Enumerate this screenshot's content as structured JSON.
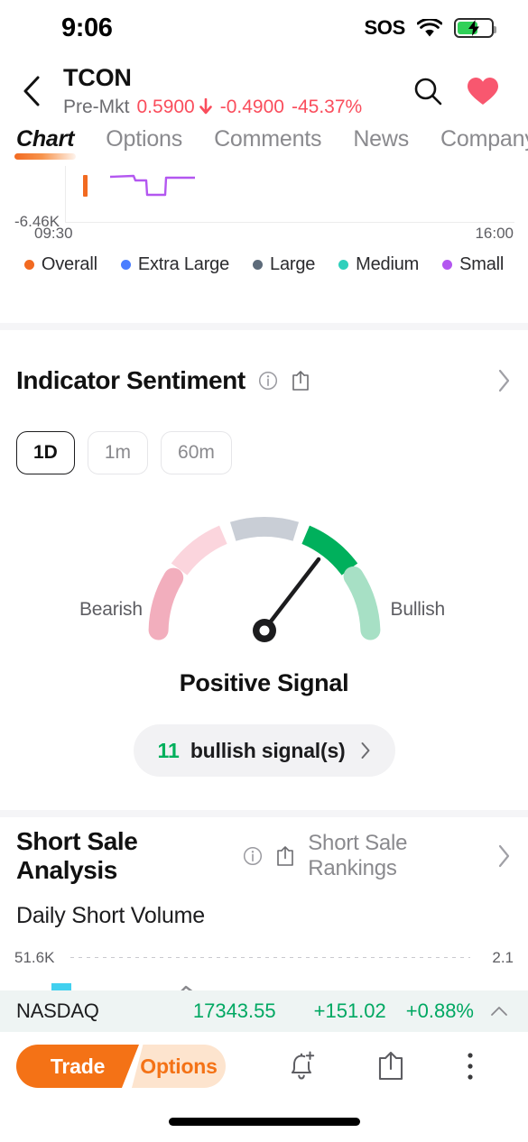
{
  "status_bar": {
    "time": "9:06",
    "sos": "SOS",
    "wifi_icon": "wifi-icon",
    "battery_icon": "battery-charging-icon"
  },
  "header": {
    "back_icon": "chevron-left-icon",
    "ticker": "TCON",
    "session_label": "Pre-Mkt",
    "price": "0.5900",
    "direction_icon": "arrow-down-icon",
    "change": "-0.4900",
    "change_pct": "-45.37%",
    "search_icon": "search-icon",
    "favorite_icon": "heart-icon",
    "negative_color": "#fa4d5c"
  },
  "tabs": [
    {
      "label": "Chart",
      "active": true
    },
    {
      "label": "Options",
      "active": false
    },
    {
      "label": "Comments",
      "active": false
    },
    {
      "label": "News",
      "active": false
    },
    {
      "label": "Company",
      "active": false
    }
  ],
  "top_chart": {
    "y_axis_label": "-6.46K",
    "x_start": "09:30",
    "x_end": "16:00",
    "legend": [
      {
        "label": "Overall",
        "color": "#f26a21"
      },
      {
        "label": "Extra Large",
        "color": "#4a7dff"
      },
      {
        "label": "Large",
        "color": "#5d6b7a"
      },
      {
        "label": "Medium",
        "color": "#2fd0bc"
      },
      {
        "label": "Small",
        "color": "#b357f0"
      }
    ]
  },
  "indicator_sentiment": {
    "title": "Indicator Sentiment",
    "info_icon": "info-icon",
    "share_icon": "share-icon",
    "chevron_icon": "chevron-right-icon",
    "periods": [
      {
        "label": "1D",
        "active": true
      },
      {
        "label": "1m",
        "active": false
      },
      {
        "label": "60m",
        "active": false
      }
    ],
    "gauge": {
      "left_label": "Bearish",
      "right_label": "Bullish",
      "needle_value": 0.72,
      "segments": [
        {
          "name": "strong-bearish",
          "color": "#f2aebd"
        },
        {
          "name": "bearish",
          "color": "#fbd5dd"
        },
        {
          "name": "neutral",
          "color": "#c9ced6"
        },
        {
          "name": "bullish",
          "color": "#00b05c"
        },
        {
          "name": "strong-bullish",
          "color": "#a7e0c5"
        }
      ]
    },
    "signal_text": "Positive Signal",
    "signal_button": {
      "count": "11",
      "label": "bullish signal(s)",
      "chevron_icon": "chevron-right-icon",
      "count_color": "#00b05c"
    }
  },
  "short_sale": {
    "title": "Short Sale Analysis",
    "info_icon": "info-icon",
    "share_icon": "share-icon",
    "rankings_link": "Short Sale Rankings",
    "chevron_icon": "chevron-right-icon",
    "subtitle": "Daily Short Volume",
    "chart": {
      "y_left": "51.6K",
      "y_right": "2.1",
      "bar_color": "#41d0ef",
      "line_color": "#8a8a8e"
    }
  },
  "market_ticker": {
    "name": "NASDAQ",
    "value": "17343.55",
    "change": "+151.02",
    "change_pct": "+0.88%",
    "chevron_icon": "chevron-up-icon",
    "positive_color": "#00a862"
  },
  "toolbar": {
    "trade_label": "Trade",
    "options_label": "Options",
    "alert_icon": "bell-plus-icon",
    "share_icon": "share-icon",
    "more_icon": "more-vertical-icon",
    "accent_color": "#f47216"
  }
}
